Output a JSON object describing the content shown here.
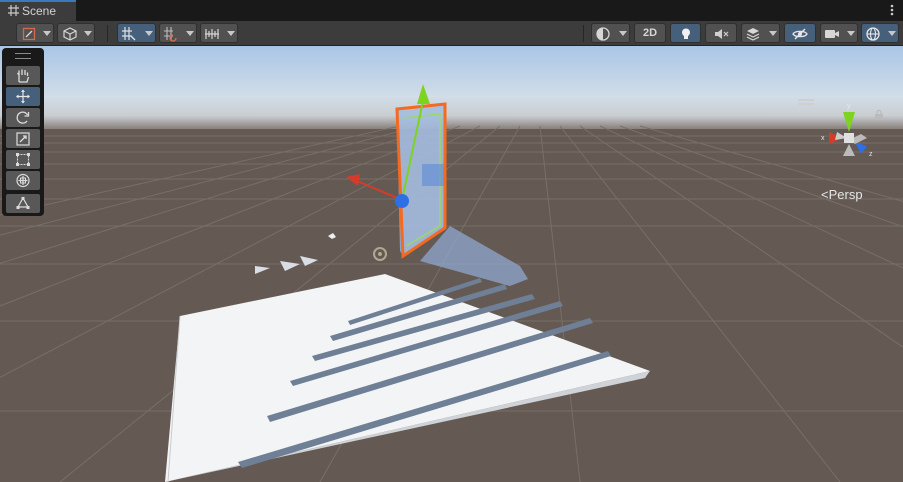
{
  "window": {
    "tab_label": "Scene",
    "tab_icon": "grid-icon",
    "menu_icon": "kebab-menu-icon"
  },
  "toolbar": {
    "two_d_label": "2D",
    "left_tools": [
      "transform-tool-icon",
      "pivot-icon",
      "grid-snap-icon",
      "increment-snap-icon",
      "ruler-icon"
    ],
    "right_tools": [
      "shading-mode-icon",
      "2d-toggle",
      "lighting-icon",
      "audio-icon",
      "effects-icon",
      "scene-visibility-icon",
      "camera-icon",
      "gizmos-icon"
    ]
  },
  "tools": {
    "items": [
      "hand-icon",
      "move-icon",
      "rotate-icon",
      "scale-icon",
      "rect-icon",
      "transform-icon",
      "custom-tool-icon"
    ],
    "active": "move-icon"
  },
  "gizmo": {
    "projection_label": "Persp",
    "axes": [
      "x",
      "y",
      "z"
    ]
  },
  "colors": {
    "accent_blue": "#3a79bb",
    "active_button": "#46607c",
    "selection_outline": "#f46a1e",
    "x_axis": "#d63b2a",
    "y_axis": "#7ed321",
    "z_axis": "#2f6fe6"
  }
}
